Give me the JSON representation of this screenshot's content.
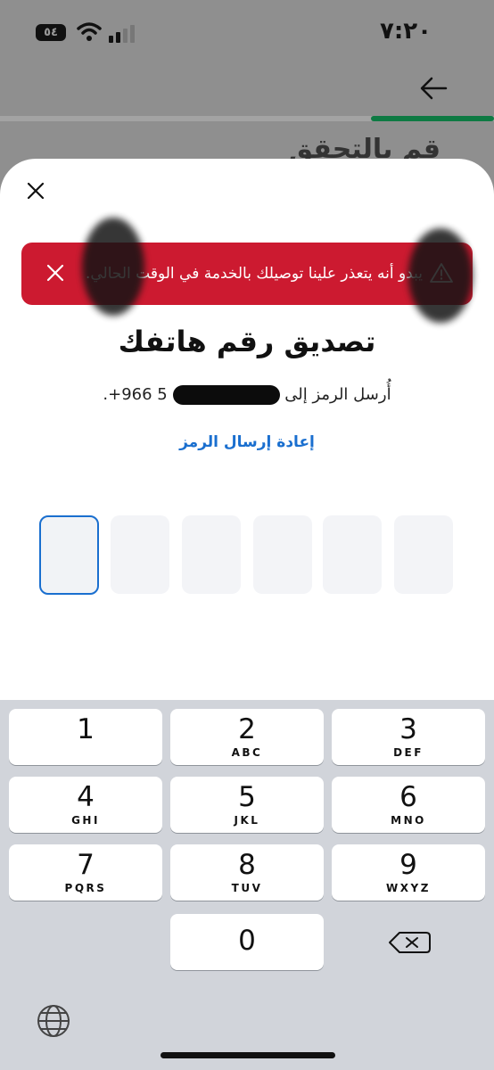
{
  "status": {
    "time": "٧:٢٠",
    "battery": "٥٤"
  },
  "progress": {
    "percent": 25
  },
  "background_heading": "قم بالتحقق",
  "alert": {
    "message": "يبدو أنه يتعذر علينا توصيلك بالخدمة في الوقت الحالي."
  },
  "verify": {
    "title": "تصديق رقم هاتفك",
    "subtitle_prefix": "أُرسل الرمز إلى",
    "phone_visible": "+966 5",
    "subtitle_suffix": ".",
    "resend_label": "إعادة إرسال الرمز"
  },
  "otp": {
    "length": 6,
    "active_index": 0
  },
  "keypad": [
    {
      "num": "1",
      "letters": ""
    },
    {
      "num": "2",
      "letters": "ABC"
    },
    {
      "num": "3",
      "letters": "DEF"
    },
    {
      "num": "4",
      "letters": "GHI"
    },
    {
      "num": "5",
      "letters": "JKL"
    },
    {
      "num": "6",
      "letters": "MNO"
    },
    {
      "num": "7",
      "letters": "PQRS"
    },
    {
      "num": "8",
      "letters": "TUV"
    },
    {
      "num": "9",
      "letters": "WXYZ"
    },
    {
      "num": "0",
      "letters": ""
    }
  ],
  "colors": {
    "alert": "#cc1a30",
    "accent": "#1a6fcf",
    "progress": "#0e7a43"
  },
  "icons": {
    "close": "close-icon",
    "back": "arrow-left-icon",
    "warning": "warning-icon",
    "delete": "backspace-icon",
    "globe": "globe-icon"
  }
}
